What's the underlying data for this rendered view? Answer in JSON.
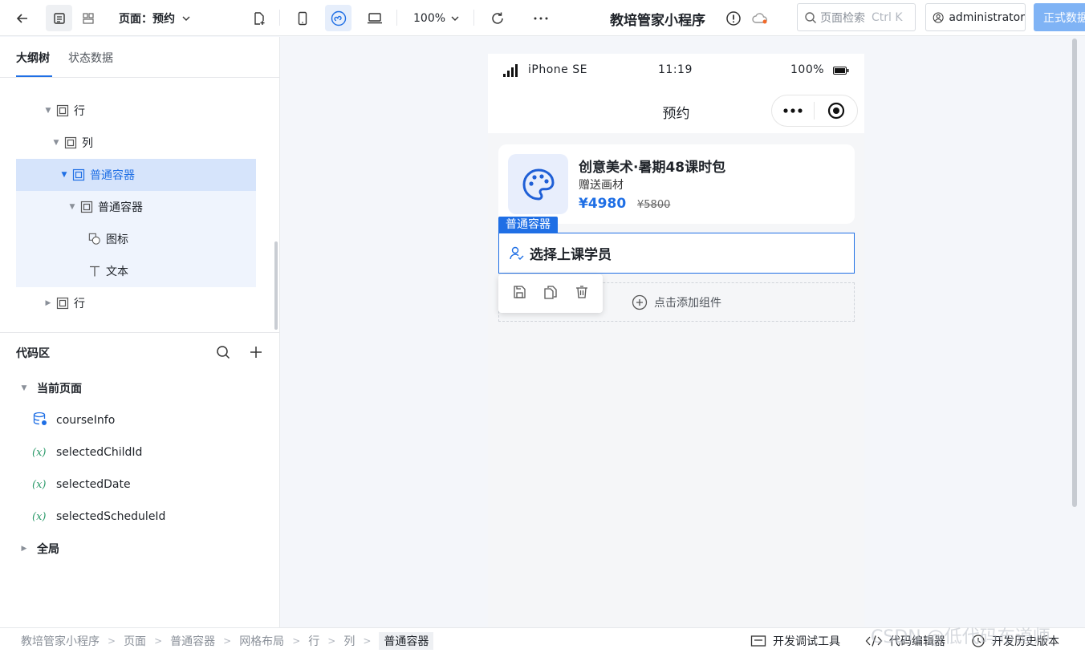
{
  "toolbar": {
    "page_label": "页面：预约",
    "zoom": "100%",
    "app_title": "教培管家小程序",
    "search_placeholder": "页面检索",
    "search_shortcut": "Ctrl K",
    "user": "administrator",
    "publish_label": "正式数据"
  },
  "left_panel": {
    "tabs": [
      "大纲树",
      "状态数据"
    ],
    "tree": [
      {
        "label": "行"
      },
      {
        "label": "列"
      },
      {
        "label": "普通容器"
      },
      {
        "label": "普通容器"
      },
      {
        "label": "图标"
      },
      {
        "label": "文本"
      },
      {
        "label": "行"
      }
    ],
    "code_area": {
      "title": "代码区",
      "current_page": "当前页面",
      "items": [
        "courseInfo",
        "selectedChildId",
        "selectedDate",
        "selectedScheduleId"
      ],
      "var_symbol": "(x)",
      "global": "全局"
    }
  },
  "phone": {
    "device": "iPhone SE",
    "time": "11:19",
    "battery": "100%",
    "nav_title": "预约",
    "course": {
      "title": "创意美术·暑期48课时包",
      "subtitle": "赠送画材",
      "price": "¥4980",
      "old_price": "¥5800"
    },
    "selected_tag": "普通容器",
    "select_student": "选择上课学员",
    "add_component": "点击添加组件"
  },
  "bottom_bar": {
    "breadcrumb": [
      "教培管家小程序",
      "页面",
      "普通容器",
      "网格布局",
      "行",
      "列",
      "普通容器"
    ],
    "dev_tools": "开发调试工具",
    "code_editor": "代码编辑器",
    "history": "开发历史版本"
  },
  "watermark": "CSDN @低代码布道师",
  "colors": {
    "accent": "#1f6fe5",
    "price": "#1f6fe5",
    "selected_row": "#d6e4fb"
  }
}
